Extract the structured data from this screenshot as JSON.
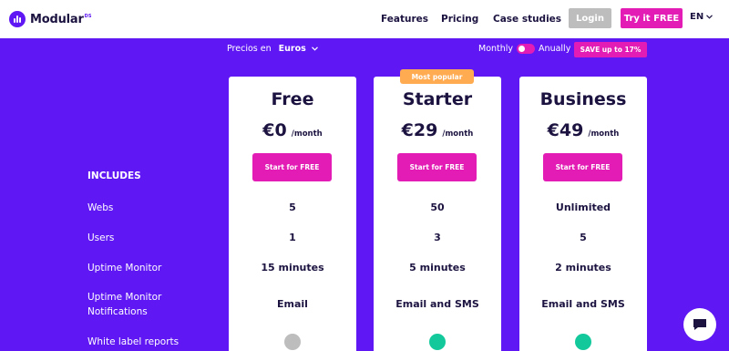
{
  "brand": {
    "name": "Modular",
    "sup": "DS"
  },
  "nav": {
    "features": "Features",
    "pricing": "Pricing",
    "case_studies": "Case studies",
    "login": "Login",
    "try": "Try it FREE",
    "lang": "EN"
  },
  "controls": {
    "currency_label": "Precios en",
    "currency_value": "Euros",
    "monthly": "Monthly",
    "annually": "Anually",
    "save": "SAVE up to 17%"
  },
  "badge": {
    "popular": "Most popular"
  },
  "features": {
    "includes": "INCLUDES",
    "webs": "Webs",
    "users": "Users",
    "uptime": "Uptime Monitor",
    "notif_line1": "Uptime Monitor",
    "notif_line2": "Notifications",
    "white_label": "White label reports"
  },
  "plans": [
    {
      "name": "Free",
      "price": "€0",
      "period": "/month",
      "cta": "Start for FREE",
      "webs": "5",
      "users": "1",
      "uptime": "15 minutes",
      "notifications": "Email",
      "white_label_color": "#bdbdbd"
    },
    {
      "name": "Starter",
      "price": "€29",
      "period": "/month",
      "cta": "Start for FREE",
      "webs": "50",
      "users": "3",
      "uptime": "5 minutes",
      "notifications": "Email and SMS",
      "white_label_color": "#13c99c"
    },
    {
      "name": "Business",
      "price": "€49",
      "period": "/month",
      "cta": "Start for FREE",
      "webs": "Unlimited",
      "users": "5",
      "uptime": "2 minutes",
      "notifications": "Email and SMS",
      "white_label_color": "#13c99c"
    }
  ],
  "colors": {
    "brand_purple": "#5f18f3",
    "accent_pink": "#e21cb4",
    "included_green": "#13c99c",
    "not_included_gray": "#bdbdbd",
    "popular_orange": "#ffab52"
  }
}
